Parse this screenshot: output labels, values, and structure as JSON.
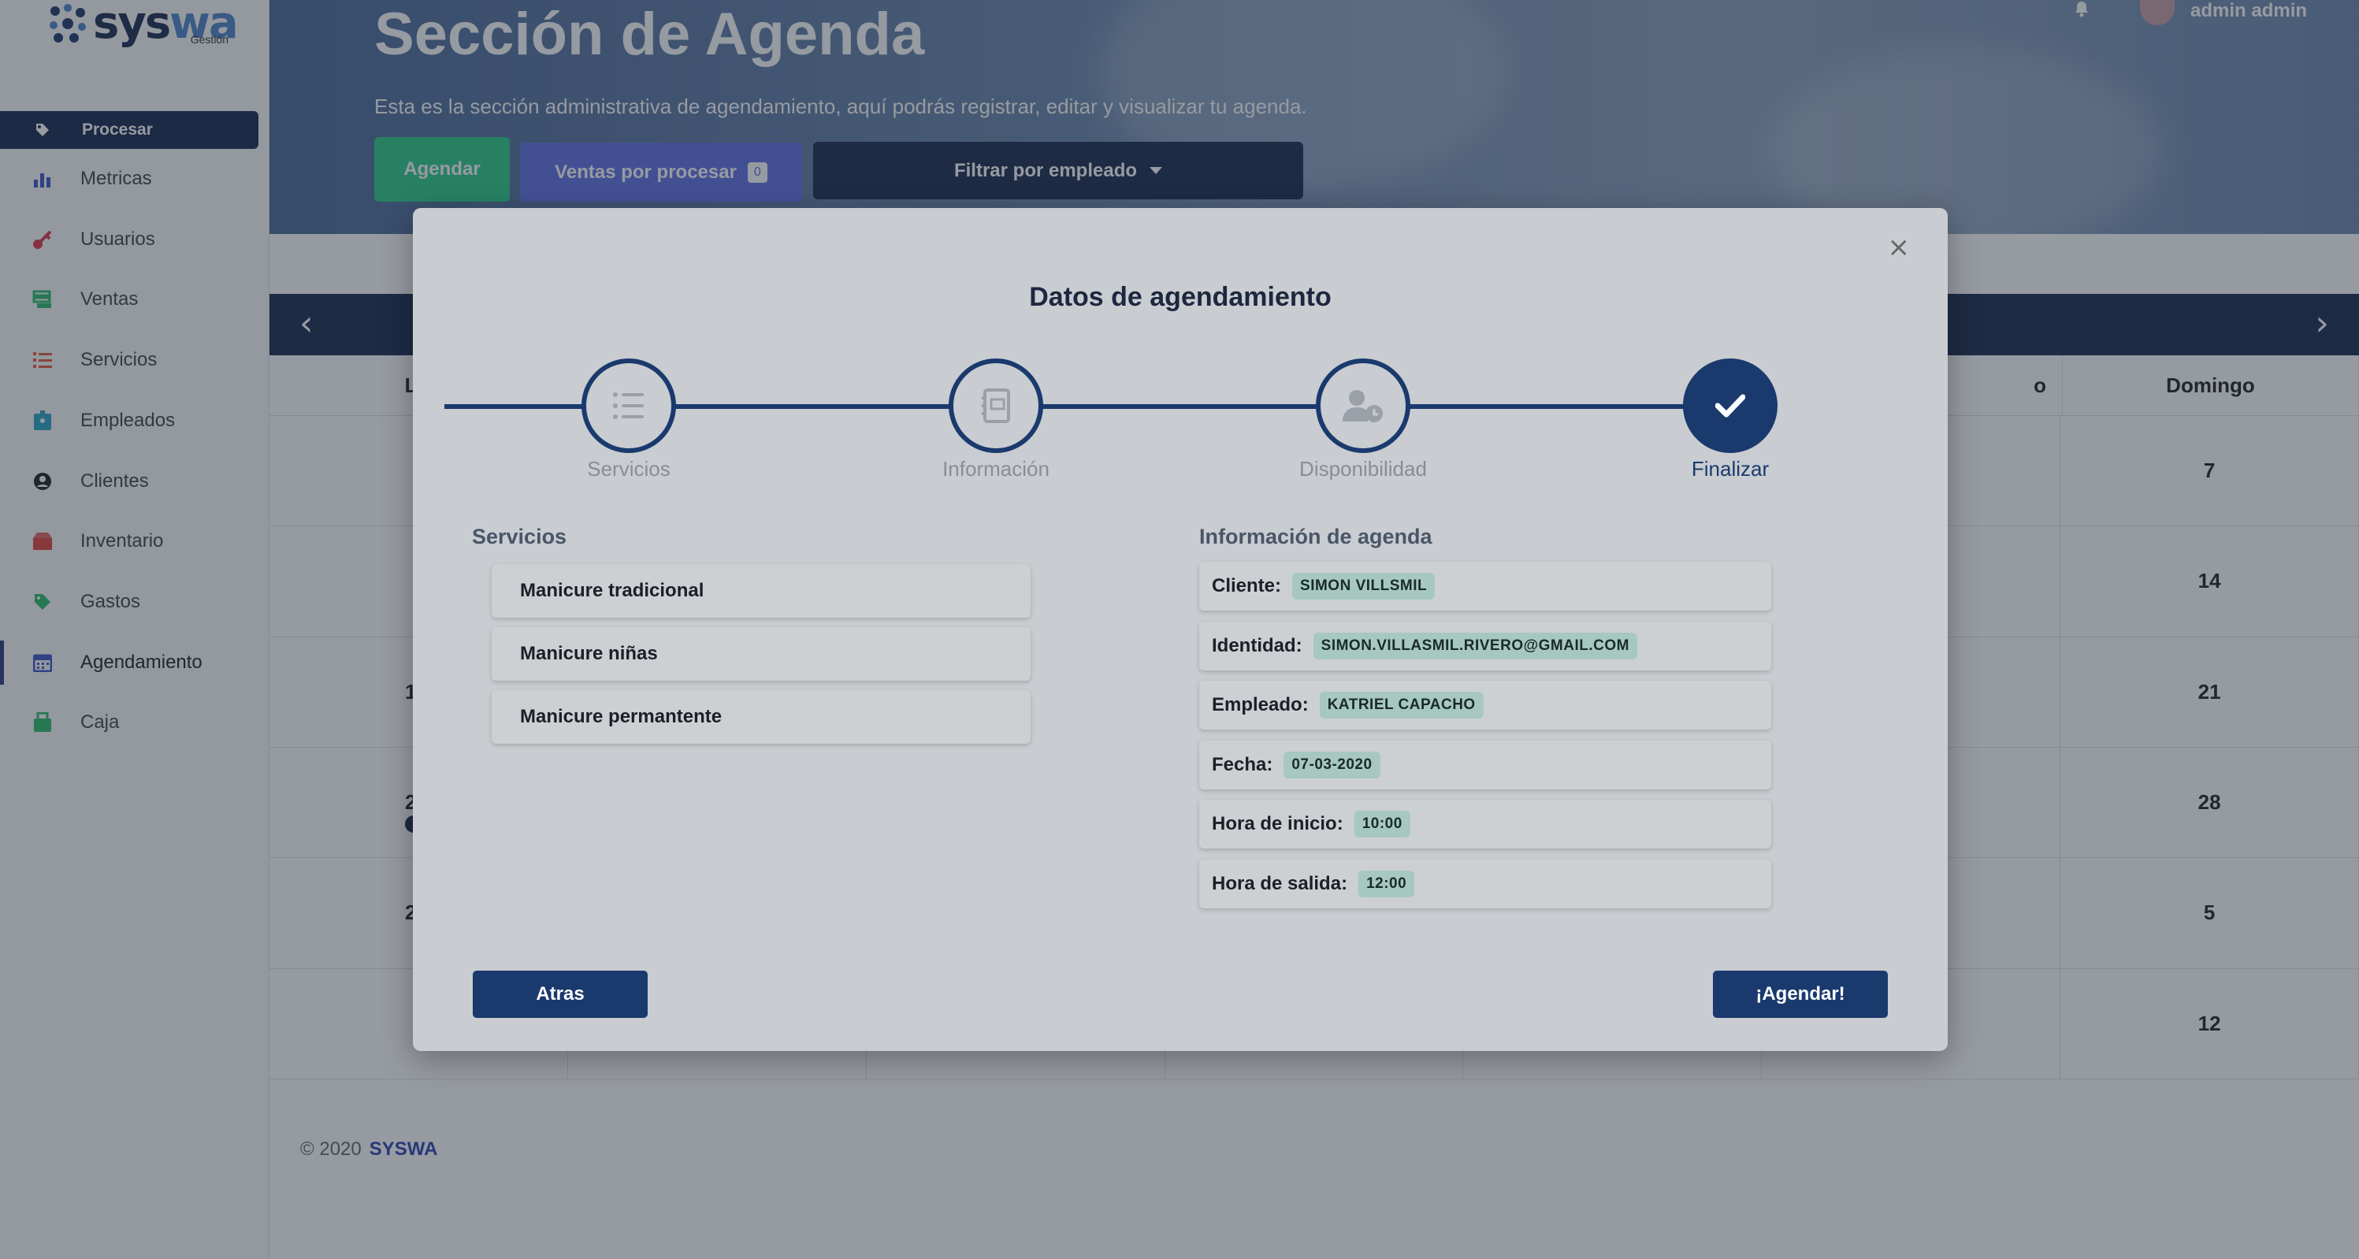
{
  "brand": {
    "logo_text_a": "sys",
    "logo_text_b": "wa",
    "logo_sub": "Gestión"
  },
  "sidebar": {
    "active_label": "Procesar",
    "items": [
      {
        "label": "Metricas",
        "icon": "bar-chart-icon",
        "color": "#3a56c8"
      },
      {
        "label": "Usuarios",
        "icon": "key-icon",
        "color": "#e0344a"
      },
      {
        "label": "Ventas",
        "icon": "stack-icon",
        "color": "#2dbe6c"
      },
      {
        "label": "Servicios",
        "icon": "list-icon",
        "color": "#e85a3c"
      },
      {
        "label": "Empleados",
        "icon": "id-badge-icon",
        "color": "#2aa5c8"
      },
      {
        "label": "Clientes",
        "icon": "user-circle-icon",
        "color": "#222222"
      },
      {
        "label": "Inventario",
        "icon": "box-icon",
        "color": "#e0443c"
      },
      {
        "label": "Gastos",
        "icon": "tag-icon",
        "color": "#2dbe6c"
      },
      {
        "label": "Agendamiento",
        "icon": "calendar-icon",
        "color": "#3a56c8"
      },
      {
        "label": "Caja",
        "icon": "register-icon",
        "color": "#2dbe6c"
      }
    ]
  },
  "header": {
    "title": "Sección de Agenda",
    "subtitle": "Esta es la sección administrativa de agendamiento, aquí podrás registrar, editar y visualizar tu agenda.",
    "agendar_label": "Agendar",
    "ventas_label": "Ventas por procesar",
    "ventas_count": "0",
    "filtrar_label": "Filtrar por empleado",
    "user_name": "admin admin"
  },
  "calendar": {
    "prev": "‹",
    "next": "›",
    "weekday_first_partial": "Lu",
    "weekday_sixth_partial": "o",
    "weekday_last": "Domingo",
    "monday_partial": [
      "",
      "",
      "1",
      "2",
      "2",
      ""
    ],
    "sunday_values": [
      "7",
      "14",
      "21",
      "28",
      "5",
      "12"
    ]
  },
  "footer": {
    "copy": "© 2020",
    "brand": "SYSWA"
  },
  "modal": {
    "close": "×",
    "title": "Datos de agendamiento",
    "steps": [
      "Servicios",
      "Información",
      "Disponibilidad",
      "Finalizar"
    ],
    "services_title": "Servicios",
    "services": [
      "Manicure tradicional",
      "Manicure niñas",
      "Manicure permantente"
    ],
    "info_title": "Información de agenda",
    "info": [
      {
        "label": "Cliente:",
        "value": "SIMON VILLSMIL"
      },
      {
        "label": "Identidad:",
        "value": "SIMON.VILLASMIL.RIVERO@GMAIL.COM"
      },
      {
        "label": "Empleado:",
        "value": "KATRIEL CAPACHO"
      },
      {
        "label": "Fecha:",
        "value": "07-03-2020"
      },
      {
        "label": "Hora de inicio:",
        "value": "10:00"
      },
      {
        "label": "Hora de salida:",
        "value": "12:00"
      }
    ],
    "back_label": "Atras",
    "submit_label": "¡Agendar!"
  }
}
